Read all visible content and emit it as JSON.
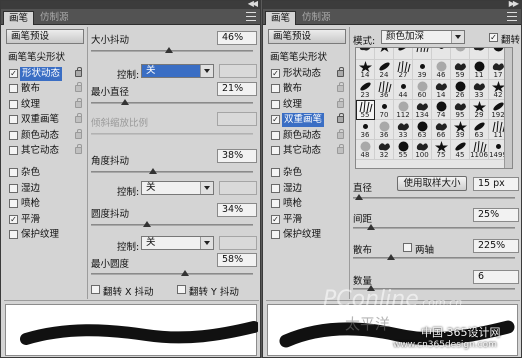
{
  "left": {
    "tabs": [
      "画笔",
      "仿制源"
    ],
    "preset_button": "画笔预设",
    "tip_shape_label": "画笔笔尖形状",
    "options": [
      {
        "label": "形状动态",
        "checked": true,
        "selected": true
      },
      {
        "label": "散布",
        "checked": false
      },
      {
        "label": "纹理",
        "checked": false
      },
      {
        "label": "双重画笔",
        "checked": false
      },
      {
        "label": "颜色动态",
        "checked": false
      },
      {
        "label": "其它动态",
        "checked": false
      },
      {
        "label": "杂色",
        "checked": false
      },
      {
        "label": "湿边",
        "checked": false
      },
      {
        "label": "喷枪",
        "checked": false
      },
      {
        "label": "平滑",
        "checked": true
      },
      {
        "label": "保护纹理",
        "checked": false
      }
    ],
    "size_jitter": {
      "label": "大小抖动",
      "value": "46%"
    },
    "control1": {
      "label": "控制:",
      "value": "关"
    },
    "min_diameter": {
      "label": "最小直径",
      "value": "21%"
    },
    "tilt_scale": {
      "label": "倾斜缩放比例"
    },
    "angle_jitter": {
      "label": "角度抖动",
      "value": "38%"
    },
    "control2": {
      "label": "控制:",
      "value": "关"
    },
    "roundness_jitter": {
      "label": "圆度抖动",
      "value": "34%"
    },
    "control3": {
      "label": "控制:",
      "value": "关"
    },
    "min_roundness": {
      "label": "最小圆度",
      "value": "58%"
    },
    "flip_x": "翻转 X 抖动",
    "flip_y": "翻转 Y 抖动"
  },
  "right": {
    "tabs": [
      "画笔",
      "仿制源"
    ],
    "preset_button": "画笔预设",
    "tip_shape_label": "画笔笔尖形状",
    "options": [
      {
        "label": "形状动态",
        "checked": true
      },
      {
        "label": "散布",
        "checked": false
      },
      {
        "label": "纹理",
        "checked": false
      },
      {
        "label": "双重画笔",
        "checked": true,
        "selected": true
      },
      {
        "label": "颜色动态",
        "checked": false
      },
      {
        "label": "其它动态",
        "checked": false
      },
      {
        "label": "杂色",
        "checked": false
      },
      {
        "label": "湿边",
        "checked": false
      },
      {
        "label": "喷枪",
        "checked": false
      },
      {
        "label": "平滑",
        "checked": true
      },
      {
        "label": "保护纹理",
        "checked": false
      }
    ],
    "mode": {
      "label": "模式:",
      "value": "颜色加深"
    },
    "flip_label": "翻转",
    "brush_numbers": [
      [
        "",
        "",
        "",
        "",
        "",
        "",
        "",
        ""
      ],
      [
        "14",
        "24",
        "27",
        "39",
        "46",
        "59",
        "11",
        "17"
      ],
      [
        "23",
        "36",
        "44",
        "60",
        "14",
        "26",
        "33",
        "42"
      ],
      [
        "55",
        "70",
        "112",
        "134",
        "74",
        "95",
        "29",
        "192"
      ],
      [
        "36",
        "36",
        "33",
        "63",
        "66",
        "39",
        "63",
        "11"
      ],
      [
        "48",
        "32",
        "55",
        "100",
        "75",
        "45",
        "1106",
        "1499"
      ]
    ],
    "selected_brush": {
      "row": 3,
      "col": 0
    },
    "diameter": {
      "label": "直径",
      "button": "使用取样大小",
      "value": "15 px"
    },
    "spacing": {
      "label": "间距",
      "value": "25%"
    },
    "scatter": {
      "label": "散布",
      "both_axes": "两轴",
      "value": "225%"
    },
    "count": {
      "label": "数量",
      "value": "6"
    }
  },
  "watermarks": {
    "pconline": "PConline",
    "pconline_tld": ".com.cn",
    "site_cn": "中国·365设计网",
    "site_url": "www.cn365design.com",
    "taiping": "太平洋"
  },
  "colors": {
    "accent": "#3a6ec4",
    "panel": "#d4d4d4",
    "tabbar": "#535353"
  }
}
